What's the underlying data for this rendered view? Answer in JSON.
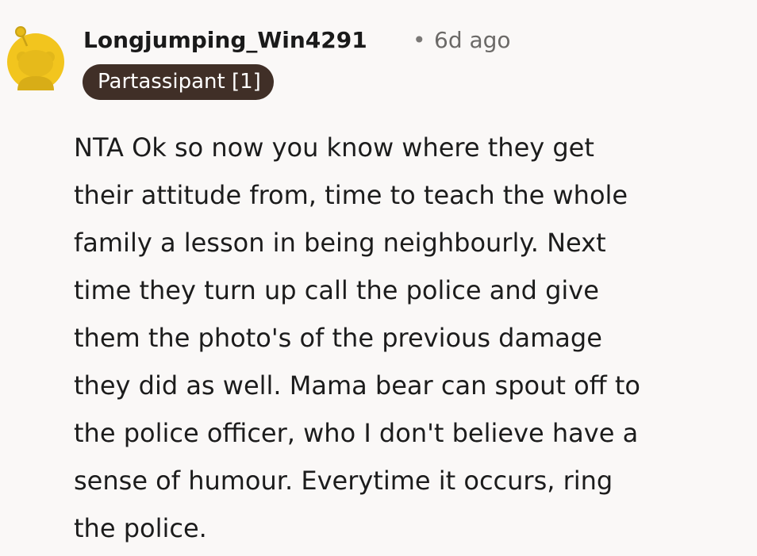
{
  "comment": {
    "avatar_icon": "snoo-avatar-icon",
    "username": "Longjumping_Win4291",
    "separator": "•",
    "timestamp": "6d ago",
    "flair": "Partassipant [1]",
    "body_lines": [
      "NTA Ok so now you know where they get",
      "their attitude from, time to teach the whole",
      "family a lesson in being neighbourly. Next",
      "time they turn up call the police and give",
      "them the photo's of the previous damage",
      "they did as well. Mama bear can spout off to",
      "the police officer, who I don't believe have a",
      "sense of humour. Everytime it occurs, ring",
      "the police."
    ]
  },
  "colors": {
    "background": "#faf8f7",
    "avatar": "#f2c51e",
    "flair_bg": "#402f27",
    "flair_text": "#ffffff",
    "meta_text": "#6b6967"
  }
}
